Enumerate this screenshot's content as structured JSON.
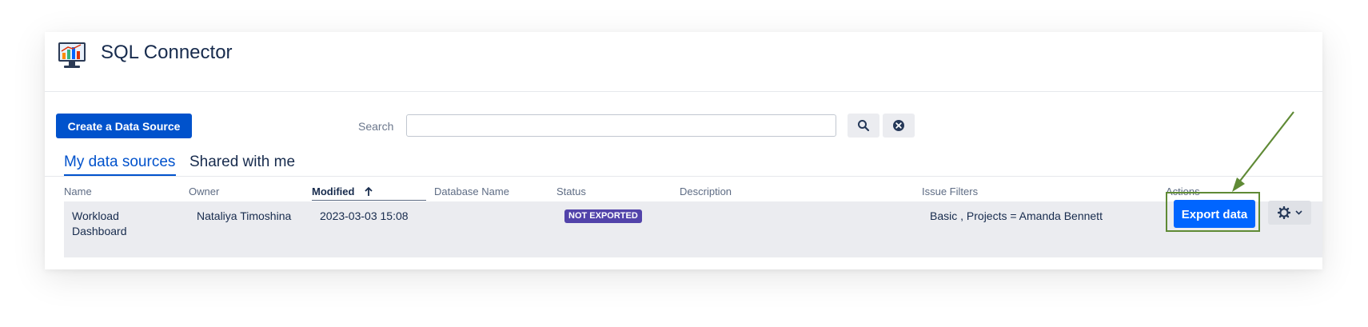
{
  "app": {
    "title": "SQL Connector",
    "icon": "chart-monitor-icon"
  },
  "toolbar": {
    "create_label": "Create a Data Source",
    "search_label": "Search",
    "search_value": "",
    "search_icon": "search-icon",
    "clear_icon": "clear-icon"
  },
  "tabs": [
    {
      "label": "My data sources",
      "active": true
    },
    {
      "label": "Shared with me",
      "active": false
    }
  ],
  "table": {
    "columns": [
      "Name",
      "Owner",
      "Modified",
      "Database Name",
      "Status",
      "Description",
      "Issue Filters",
      "Actions"
    ],
    "sorted_column": "Modified",
    "sort_direction": "ascending",
    "rows": [
      {
        "name_line1": "Workload",
        "name_line2": "Dashboard",
        "owner": "Nataliya Timoshina",
        "modified": "2023-03-03 15:08",
        "database_name": "",
        "status": "NOT EXPORTED",
        "description": "",
        "issue_filters": "Basic , Projects = Amanda Bennett",
        "action_label": "Export data"
      }
    ]
  },
  "colors": {
    "primary": "#0052cc",
    "export": "#0065ff",
    "badge": "#5243aa",
    "highlight": "#5f8a35"
  }
}
